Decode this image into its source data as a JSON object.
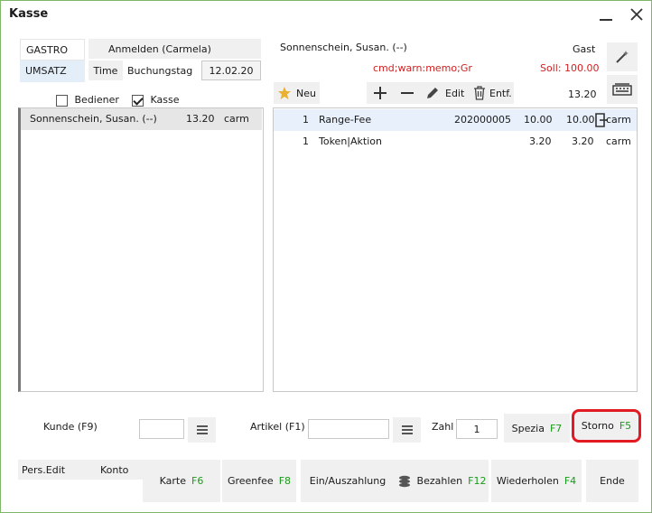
{
  "window": {
    "title": "Kasse"
  },
  "left_nav": {
    "gastro": "GASTRO",
    "umsatz": "UMSATZ"
  },
  "anmelden": "Anmelden (Carmela)",
  "time_label": "Time",
  "buchungstag_label": "Buchungstag",
  "buchungstag_value": "12.02.20",
  "filters": {
    "bediener": "Bediener",
    "kasse": "Kasse",
    "bediener_checked": false,
    "kasse_checked": true
  },
  "left_list": [
    {
      "name": "Sonnenschein, Susan. (--)",
      "amount": "13.20",
      "user": "carm"
    }
  ],
  "guest": {
    "name": "Sonnenschein, Susan. (--)",
    "type": "Gast",
    "cmd": "cmd;warn:memo;Grat",
    "soll": "Soll: 100.00",
    "total": "13.20"
  },
  "toolbar": {
    "neu": "Neu",
    "edit": "Edit",
    "entf": "Entf."
  },
  "items": [
    {
      "qty": "1",
      "name": "Range-Fee",
      "code": "202000005",
      "price": "10.00",
      "total": "10.00",
      "user": "carm"
    },
    {
      "qty": "1",
      "name": "Token|Aktion",
      "code": "",
      "price": "3.20",
      "total": "3.20",
      "user": "carm"
    }
  ],
  "bottom": {
    "kunde_label": "Kunde (F9)",
    "artikel_label": "Artikel (F1)",
    "zahl_label": "Zahl",
    "zahl_value": "1",
    "spezial": "Spezia",
    "spezial_key": "F7",
    "storno": "Storno",
    "storno_key": "F5",
    "pers_edit": "Pers.Edit",
    "konto": "Konto",
    "karte": "Karte",
    "karte_key": "F6",
    "greenfee": "Greenfee",
    "greenfee_key": "F8",
    "einauszahlung": "Ein/Auszahlung",
    "bezahlen": "Bezahlen",
    "bezahlen_key": "F12",
    "wiederholen": "Wiederholen",
    "wiederholen_key": "F4",
    "ende": "Ende"
  },
  "colors": {
    "accent_green": "#1a9a1a",
    "warn_red": "#d02020",
    "highlight_ring": "#e21b23",
    "selected_row": "#e8f0fb"
  }
}
